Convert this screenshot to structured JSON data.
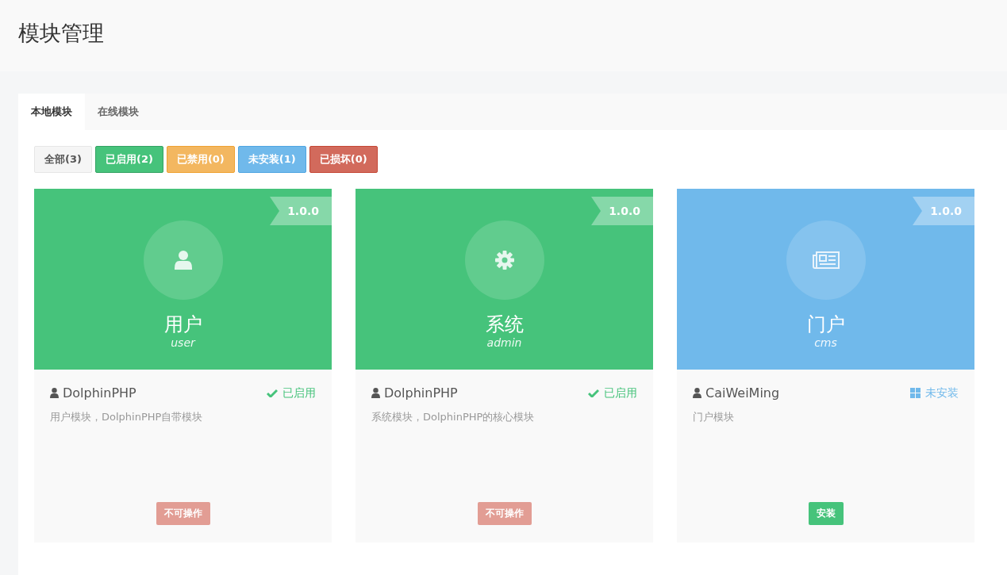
{
  "page_title": "模块管理",
  "tabs": [
    {
      "label": "本地模块",
      "selected": true
    },
    {
      "label": "在线模块",
      "selected": false
    }
  ],
  "filters": [
    {
      "label": "全部(3)",
      "kind": "all"
    },
    {
      "label": "已启用(2)",
      "kind": "enabled"
    },
    {
      "label": "已禁用(0)",
      "kind": "disabled"
    },
    {
      "label": "未安装(1)",
      "kind": "uninstalled"
    },
    {
      "label": "已损坏(0)",
      "kind": "damaged"
    }
  ],
  "modules": [
    {
      "title": "用户",
      "name": "user",
      "version": "1.0.0",
      "kind": "enabled",
      "status_label": "已启用",
      "author": "DolphinPHP",
      "description": "用户模块，DolphinPHP自带模块",
      "action": {
        "label": "不可操作",
        "kind": "locked"
      }
    },
    {
      "title": "系统",
      "name": "admin",
      "version": "1.0.0",
      "kind": "enabled",
      "status_label": "已启用",
      "author": "DolphinPHP",
      "description": "系统模块，DolphinPHP的核心模块",
      "action": {
        "label": "不可操作",
        "kind": "locked"
      }
    },
    {
      "title": "门户",
      "name": "cms",
      "version": "1.0.0",
      "kind": "uninstalled",
      "status_label": "未安装",
      "author": "CaiWeiMing",
      "description": "门户模块",
      "action": {
        "label": "安装",
        "kind": "install"
      }
    }
  ]
}
